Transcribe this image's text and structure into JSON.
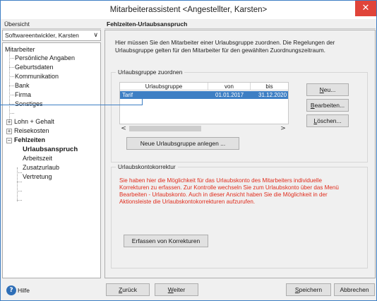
{
  "window": {
    "title": "Mitarbeiterassistent <Angestellter, Karsten>",
    "close_glyph": "✕"
  },
  "left": {
    "header": "Übersicht",
    "profile_select": {
      "value": "Softwareentwickler, Karsten",
      "chevron": "∨"
    },
    "tree": [
      {
        "label": "Mitarbeiter"
      },
      {
        "label": "Persönliche Angaben"
      },
      {
        "label": "Geburtsdaten"
      },
      {
        "label": "Kommunikation"
      },
      {
        "label": "Bank"
      },
      {
        "label": "Firma"
      },
      {
        "label": "Sonstiges"
      },
      {
        "label": "Lohn + Gehalt",
        "expander": "+"
      },
      {
        "label": "Reisekosten",
        "expander": "+"
      },
      {
        "label": "Fehlzeiten",
        "expander": "−"
      },
      {
        "label": "Urlaubsanspruch"
      },
      {
        "label": "Arbeitszeit"
      },
      {
        "label": "Zusatzurlaub"
      },
      {
        "label": "Vertretung"
      }
    ]
  },
  "right": {
    "header": "Fehlzeiten-Urlaubsanspruch",
    "intro": "Hier müssen Sie den Mitarbeiter einer Urlaubsgruppe zuordnen. Die Regelungen der Urlaubsgruppe gelten für den Mitarbeiter für den gewählten Zuordnungszeitraum.",
    "assign_group": {
      "label": "Urlaubsgruppe zuordnen",
      "columns": [
        "Urlaubsgruppe",
        "von",
        "bis"
      ],
      "rows": [
        {
          "group": "Tarif",
          "from": "01.01.2017",
          "to": "31.12.2020"
        }
      ],
      "scroll_left": "<",
      "scroll_right": ">",
      "new_button": "Neue Urlaubsgruppe anlegen ...",
      "side_buttons": {
        "new_hotkey": "N",
        "new_rest": "eu...",
        "edit_hotkey": "B",
        "edit_rest": "earbeiten...",
        "delete_hotkey": "L",
        "delete_rest": "öschen..."
      }
    },
    "correction": {
      "label": "Urlaubskontokorrektur",
      "text": "Sie haben hier die Möglichkeit für das Urlaubskonto des Mitarbeiters individuelle Korrekturen zu erfassen. Zur Kontrolle wechseln Sie zum  Urlaubskonto über das Menü Bearbeiten - Urlaubskonto. Auch in dieser Ansicht haben Sie die Möglichkeit in der Aktionsleiste die Urlaubskontokorrekturen aufzurufen.",
      "button": "Erfassen von Korrekturen"
    }
  },
  "bottom": {
    "help_icon": "?",
    "help_label": "Hilfe",
    "back_hotkey": "Z",
    "back_rest": "urück",
    "next_hotkey": "W",
    "next_rest": "eiter",
    "save_hotkey": "S",
    "save_rest": "peichern",
    "cancel": "Abbrechen"
  },
  "colors": {
    "accent": "#3e7fc4",
    "close_red": "#e0443a",
    "warning_text": "#e02c1c"
  }
}
